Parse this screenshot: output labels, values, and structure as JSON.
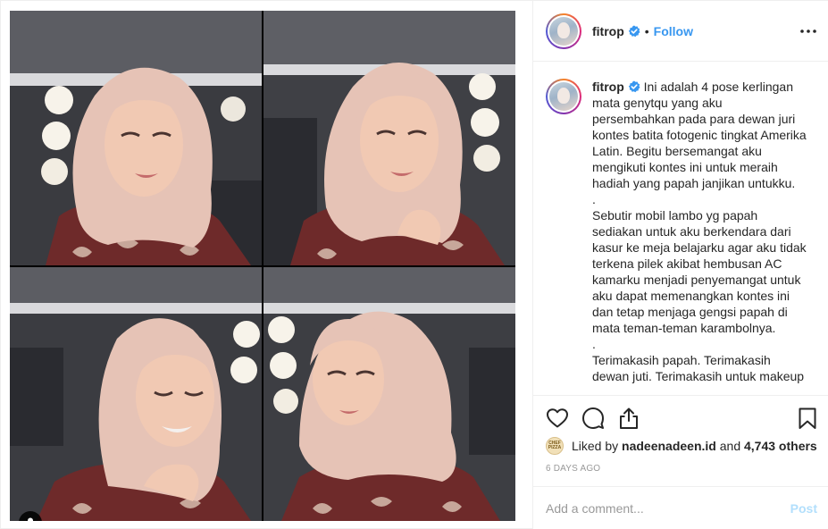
{
  "post": {
    "username": "fitrop",
    "verified": true,
    "follow_separator": "•",
    "follow_label": "Follow",
    "caption_user": "fitrop",
    "caption": "Ini adalah 4 pose kerlingan mata genytqu yang aku persembahkan pada para dewan juri kontes batita fotogenic tingkat Amerika Latin. Begitu bersemangat aku mengikuti kontes ini untuk meraih hadiah yang papah janjikan untukku.\n.\nSebutir mobil lambo yg papah sediakan untuk aku berkendara dari kasur ke meja belajarku agar aku tidak terkena pilek akibat hembusan AC kamarku menjadi penyemangat untuk aku dapat memenangkan kontes ini dan tetap menjaga gengsi papah di mata teman-teman karambolnya.\n.\nTerimakasih papah. Terimakasih dewan juti. Terimakasih untuk makeup",
    "likes_prefix": "Liked by ",
    "likes_user": "nadeenadeen.id",
    "likes_mid": " and ",
    "likes_count": "4,743 others",
    "liker_avatar_text": "CHEF PIZZA",
    "timestamp": "6 DAYS AGO",
    "comment_placeholder": "Add a comment...",
    "post_label": "Post"
  },
  "icons": {
    "verified": "verified-badge-icon",
    "more": "more-options-icon",
    "like": "heart-icon",
    "comment": "comment-bubble-icon",
    "share": "share-icon",
    "save": "bookmark-icon",
    "user_tag": "user-tag-icon"
  },
  "colors": {
    "link_blue": "#3897f0",
    "post_disabled": "#b2dffc",
    "text": "#262626",
    "muted": "#999999",
    "border": "#efefef",
    "hijab": "#e6c3b6",
    "dress": "#6e2a2a"
  }
}
